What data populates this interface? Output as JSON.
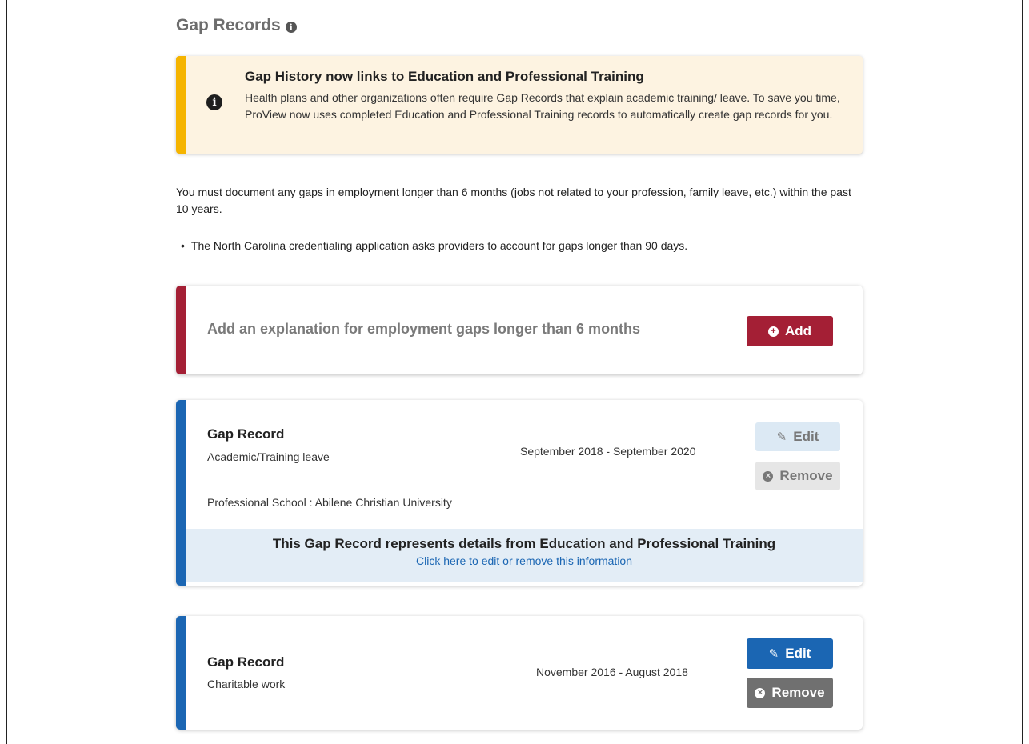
{
  "page": {
    "title": "Gap Records",
    "title_icon": "info-circle-icon"
  },
  "notice": {
    "icon": "info-circle-icon",
    "title": "Gap History now links to Education and Professional Training",
    "body": "Health plans and other organizations often require Gap Records that explain academic training/ leave. To save you time, ProView now uses completed Education and Professional Training records to automatically create gap records for you.",
    "accent_color": "#f5b400"
  },
  "intro": {
    "text": "You must document any gaps in employment longer than 6 months (jobs not related to your profession, family leave, etc.) within the past 10 years.",
    "bullet": "The North Carolina credentialing application asks providers to account for gaps longer than 90 days."
  },
  "add_card": {
    "text": "Add an explanation for employment gaps longer than 6 months",
    "button_label": "Add",
    "button_icon": "plus-circle-icon",
    "accent_color": "#a41f35"
  },
  "records": [
    {
      "title": "Gap Record",
      "type": "Academic/Training leave",
      "dates": "September 2018 - September 2020",
      "detail": "Professional School : Abilene Christian University",
      "edit_label": "Edit",
      "remove_label": "Remove",
      "buttons_disabled": true,
      "footer_title": "This Gap Record represents details from Education and Professional Training",
      "footer_link": "Click here to edit or remove this information"
    },
    {
      "title": "Gap Record",
      "type": "Charitable work",
      "dates": "November 2016 - August 2018",
      "edit_label": "Edit",
      "remove_label": "Remove",
      "buttons_disabled": false
    }
  ],
  "colors": {
    "record_accent": "#1b66b3",
    "edit_button": "#1b66b3",
    "remove_button": "#707070"
  }
}
